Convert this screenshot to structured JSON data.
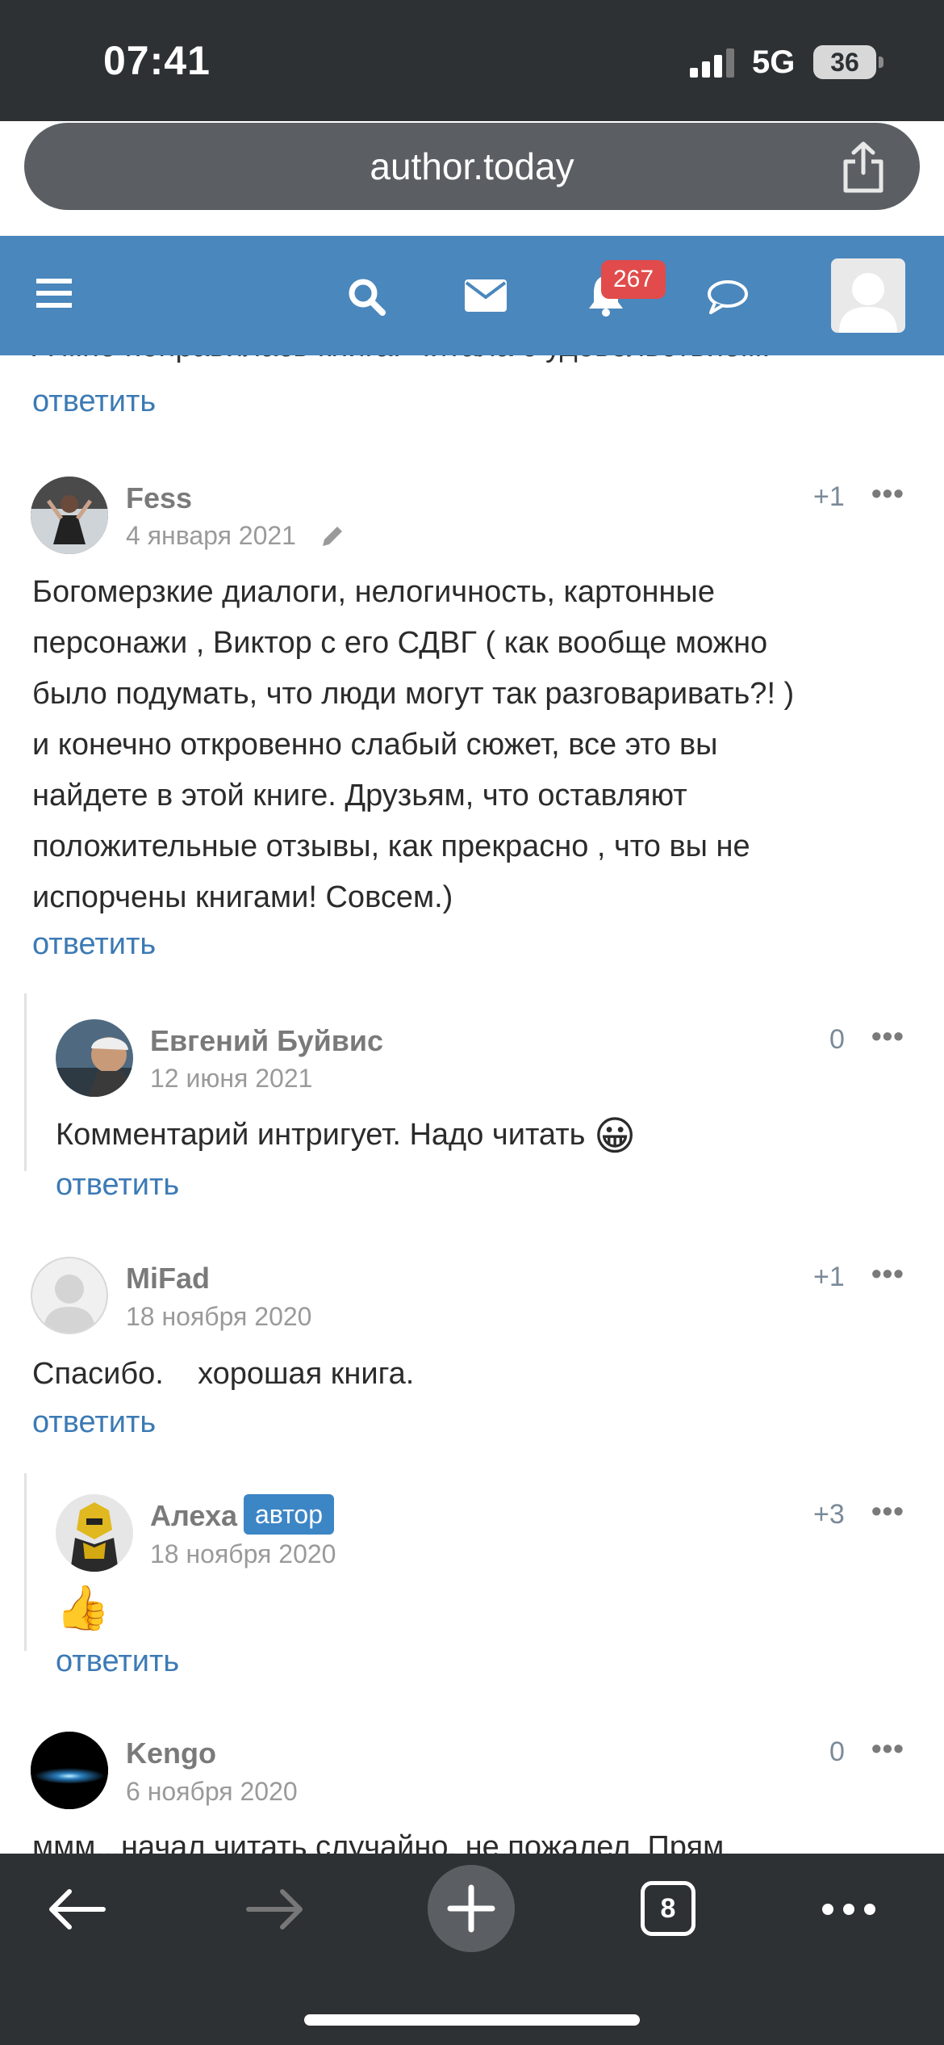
{
  "status_bar": {
    "time": "07:41",
    "network": "5G",
    "battery": "36"
  },
  "browser": {
    "url": "author.today",
    "share_icon": "share-icon",
    "tab_count": "8"
  },
  "topnav": {
    "icons": [
      "menu-icon",
      "search-icon",
      "mail-icon",
      "bell-icon",
      "chat-icon"
    ],
    "notification_count": "267",
    "accent_color": "#4a87bd"
  },
  "comments": {
    "prev_text": "А мне понравилась книга. Читала с удовольствием.",
    "prev_reply": "ответить",
    "items": [
      {
        "author": "Fess",
        "date": "4 января 2021",
        "score": "+1",
        "lines": [
          "Богомерзкие диалоги, нелогичность, картонные",
          "персонажи , Виктор с его СДВГ ( как вообще можно",
          "было подумать, что люди могут так разговаривать?! )",
          "и конечно откровенно слабый сюжет,  все это вы",
          "найдете в этой книге. Друзьям, что оставляют",
          "положительные отзывы, как прекрасно , что вы не",
          "испорчены книгами! Совсем.)"
        ],
        "reply": "ответить"
      },
      {
        "author": "Евгений Буйвис",
        "date": "12 июня 2021",
        "score": "0",
        "text": "Комментарий интригует. Надо читать",
        "emoji": "😀",
        "reply": "ответить"
      },
      {
        "author": "MiFad",
        "date": "18 ноября 2020",
        "score": "+1",
        "text": "Спасибо.    хорошая книга.",
        "reply": "ответить"
      },
      {
        "author": "Алеха",
        "badge": "автор",
        "date": "18 ноября 2020",
        "score": "+3",
        "emoji": "👍",
        "reply": "ответить"
      },
      {
        "author": "Kengo",
        "date": "6 ноября 2020",
        "score": "0",
        "text": "ммм...начал читать случайно, не пожалел. Прям"
      }
    ]
  },
  "dots_label": "•••"
}
